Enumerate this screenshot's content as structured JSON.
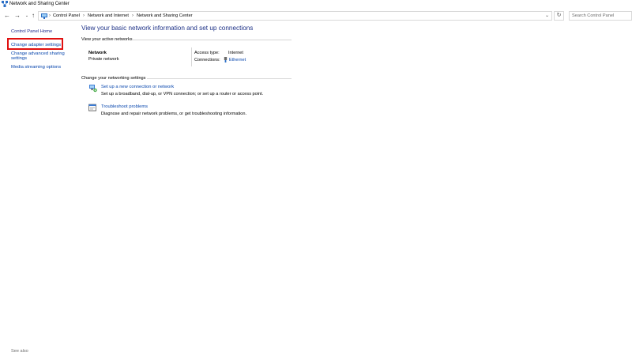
{
  "window": {
    "title": "Network and Sharing Center"
  },
  "address": {
    "crumbs": [
      "Control Panel",
      "Network and Internet",
      "Network and Sharing Center"
    ],
    "search_placeholder": "Search Control Panel"
  },
  "sidebar": {
    "home": "Control Panel Home",
    "items": [
      {
        "label": "Change adapter settings"
      },
      {
        "label_line1": "Change advanced sharing",
        "label_line2": "settings"
      },
      {
        "label": "Media streaming options"
      }
    ],
    "see_also": "See also"
  },
  "main": {
    "heading": "View your basic network information and set up connections",
    "active_title": "View your active networks",
    "network": {
      "name": "Network",
      "type": "Private network",
      "access_label": "Access type:",
      "access_value": "Internet",
      "connections_label": "Connections:",
      "connections_value": "Ethernet"
    },
    "settings_title": "Change your networking settings",
    "tasks": [
      {
        "link": "Set up a new connection or network",
        "desc": "Set up a broadband, dial-up, or VPN connection; or set up a router or access point."
      },
      {
        "link": "Troubleshoot problems",
        "desc": "Diagnose and repair network problems, or get troubleshooting information."
      }
    ]
  },
  "colors": {
    "link": "#0645ad",
    "heading": "#1e3287",
    "highlight": "#e01010"
  }
}
